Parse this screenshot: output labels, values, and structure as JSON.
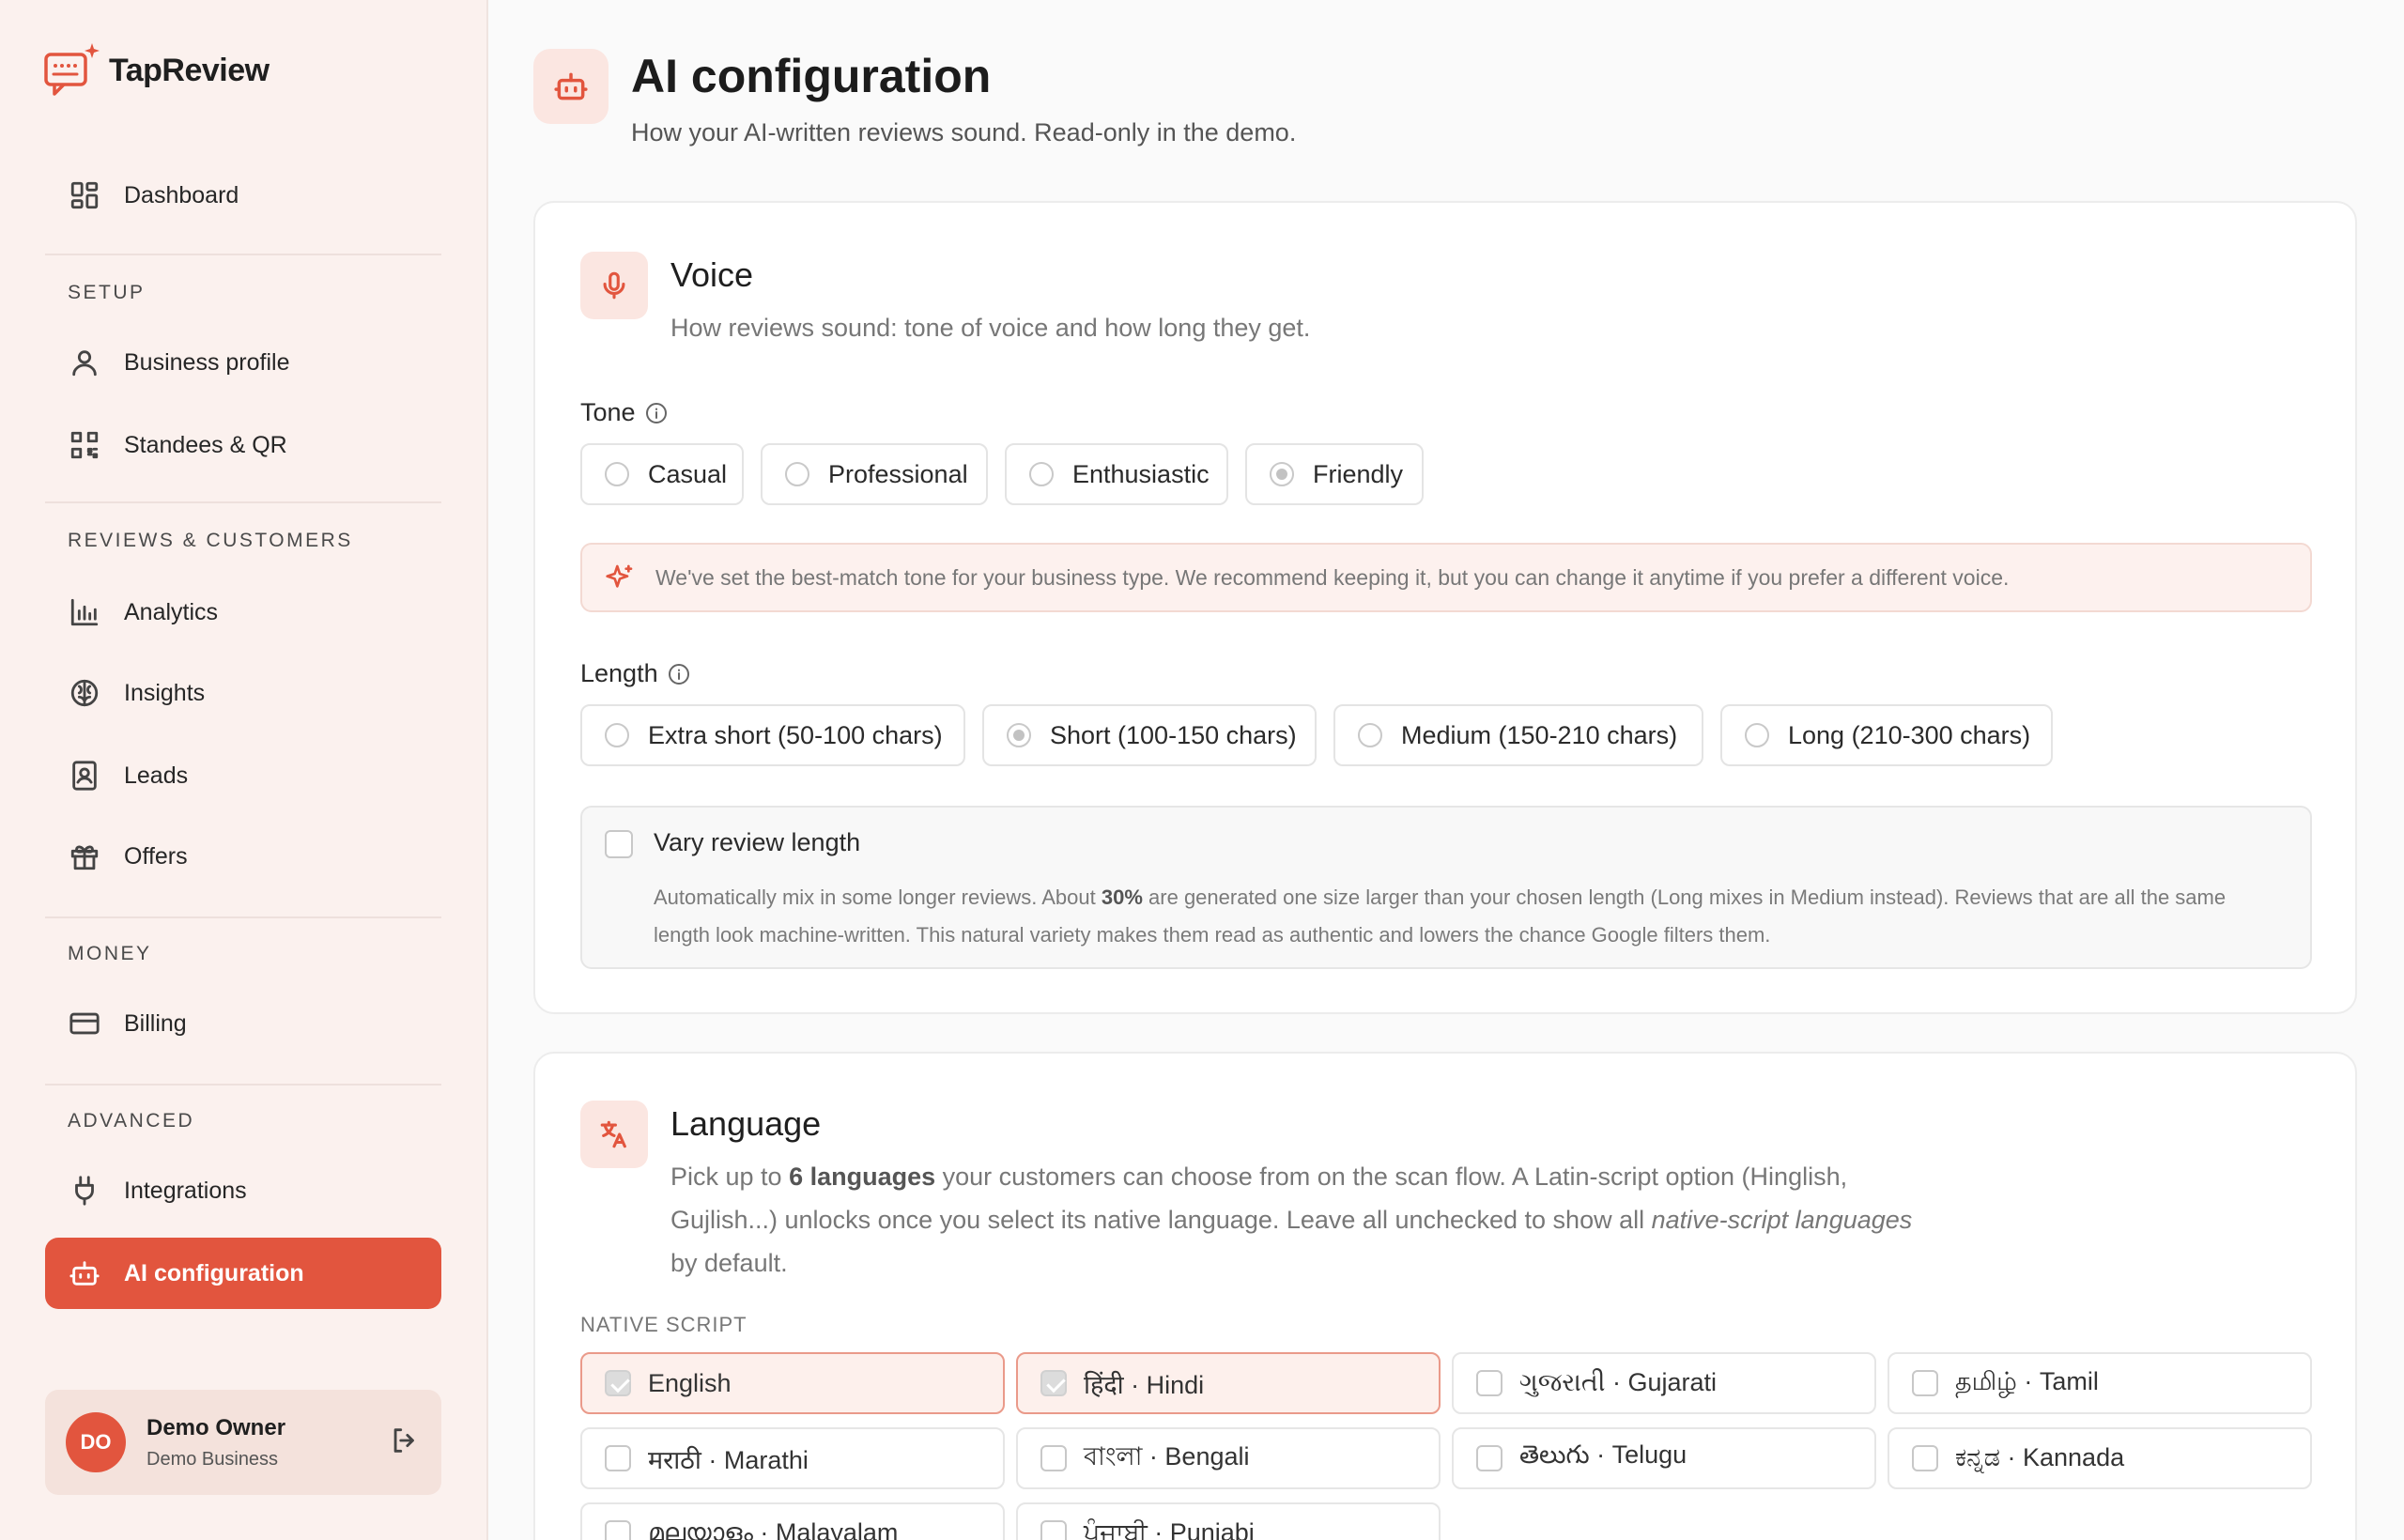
{
  "app": {
    "brand_name": "TapReview"
  },
  "sidebar": {
    "dashboard": "Dashboard",
    "sections": {
      "setup": "SETUP",
      "reviews": "REVIEWS & CUSTOMERS",
      "money": "MONEY",
      "advanced": "ADVANCED"
    },
    "items": {
      "business_profile": "Business profile",
      "standees": "Standees & QR",
      "analytics": "Analytics",
      "insights": "Insights",
      "leads": "Leads",
      "offers": "Offers",
      "billing": "Billing",
      "integrations": "Integrations",
      "ai_config": "AI configuration"
    },
    "user": {
      "initials": "DO",
      "name": "Demo Owner",
      "business": "Demo Business"
    }
  },
  "header": {
    "title": "AI configuration",
    "subtitle": "How your AI-written reviews sound. Read-only in the demo."
  },
  "voice": {
    "title": "Voice",
    "subtitle": "How reviews sound: tone of voice and how long they get.",
    "tone_label": "Tone",
    "tones": [
      "Casual",
      "Professional",
      "Enthusiastic",
      "Friendly"
    ],
    "selected_tone": "Friendly",
    "notice": "We've set the best-match tone for your business type. We recommend keeping it, but you can change it anytime if you prefer a different voice.",
    "length_label": "Length",
    "lengths": [
      "Extra short (50-100 chars)",
      "Short (100-150 chars)",
      "Medium (150-210 chars)",
      "Long (210-300 chars)"
    ],
    "selected_length": "Short (100-150 chars)",
    "vary": {
      "title": "Vary review length",
      "checked": false,
      "text_before": "Automatically mix in some longer reviews. About ",
      "percent": "30%",
      "text_after": " are generated one size larger than your chosen length (Long mixes in Medium instead). Reviews that are all the same length look machine-written. This natural variety makes them read as authentic and lowers the chance Google filters them."
    }
  },
  "language": {
    "title": "Language",
    "sub_1": "Pick up to ",
    "sub_bold": "6 languages",
    "sub_2": " your customers can choose from on the scan flow. A Latin-script option (Hinglish, Gujlish...) unlocks once you select its native language. Leave all unchecked to show all ",
    "sub_italic": "native-script languages",
    "sub_3": " by default.",
    "native_label": "NATIVE SCRIPT",
    "options": [
      {
        "label": "English",
        "checked": true
      },
      {
        "label": "हिंदी · Hindi",
        "checked": true
      },
      {
        "label": "ગુજરાતી · Gujarati",
        "checked": false
      },
      {
        "label": "தமிழ் · Tamil",
        "checked": false
      },
      {
        "label": "मराठी · Marathi",
        "checked": false
      },
      {
        "label": "বাংলা · Bengali",
        "checked": false
      },
      {
        "label": "తెలుగు · Telugu",
        "checked": false
      },
      {
        "label": "ಕನ್ನಡ · Kannada",
        "checked": false
      },
      {
        "label": "മലയാളം · Malayalam",
        "checked": false
      },
      {
        "label": "ਪੰਜਾਬੀ · Punjabi",
        "checked": false
      }
    ]
  },
  "colors": {
    "accent": "#e2553e",
    "sidebar_bg": "#fbf1ee",
    "selected_bg": "#fdf0ec"
  }
}
